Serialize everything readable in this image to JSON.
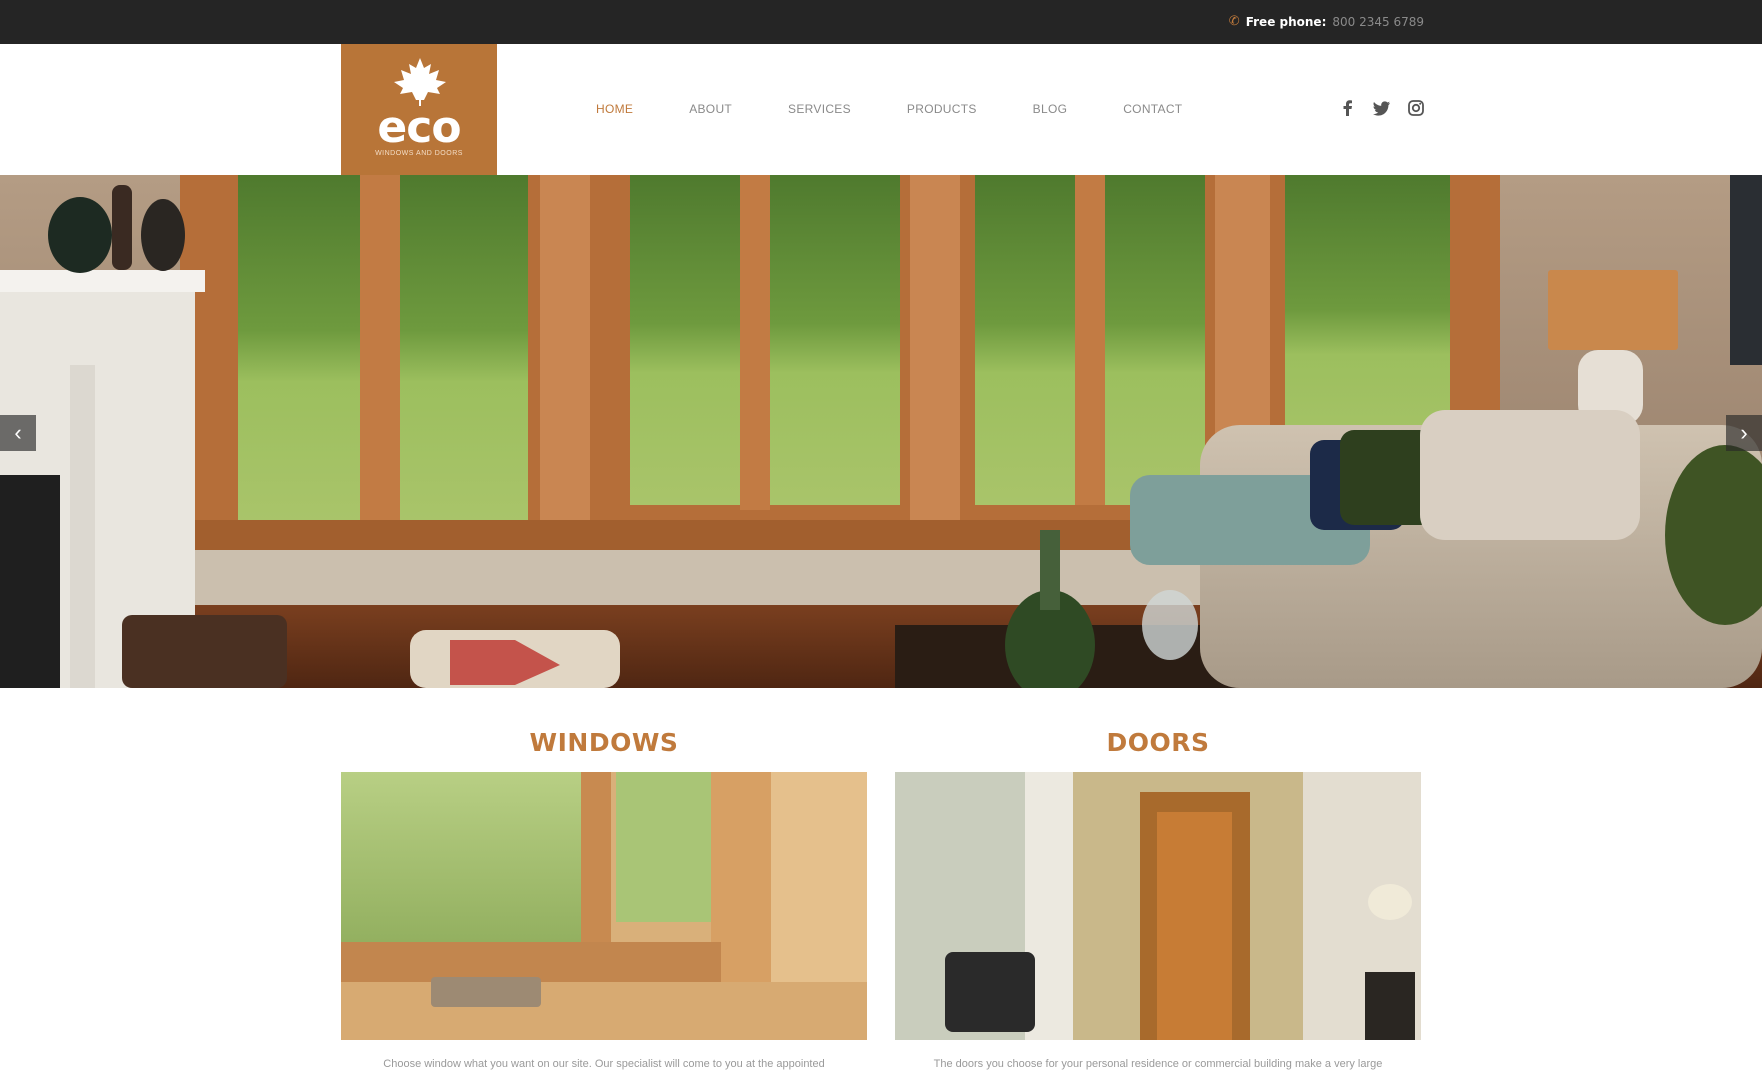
{
  "topbar": {
    "phone_label": "Free phone:",
    "phone_number": "800 2345 6789",
    "phone_icon": "phone-icon"
  },
  "logo": {
    "brand": "eco",
    "tagline": "WINDOWS AND DOORS",
    "icon": "maple-leaf-icon"
  },
  "nav": {
    "items": [
      {
        "label": "HOME",
        "active": true
      },
      {
        "label": "ABOUT",
        "active": false
      },
      {
        "label": "SERVICES",
        "active": false
      },
      {
        "label": "PRODUCTS",
        "active": false
      },
      {
        "label": "BLOG",
        "active": false
      },
      {
        "label": "CONTACT",
        "active": false
      }
    ]
  },
  "social": [
    "facebook-icon",
    "twitter-icon",
    "instagram-icon"
  ],
  "slider": {
    "prev": "‹",
    "next": "›"
  },
  "sections": {
    "windows": {
      "title": "WINDOWS",
      "text": "Choose window what you want on our site. Our specialist will come to you at the appointed"
    },
    "doors": {
      "title": "DOORS",
      "text": "The doors you choose for your personal residence or commercial building make a very large"
    }
  },
  "colors": {
    "accent": "#c07a3c",
    "logo_bg": "#b87538",
    "topbar_bg": "#252525"
  }
}
